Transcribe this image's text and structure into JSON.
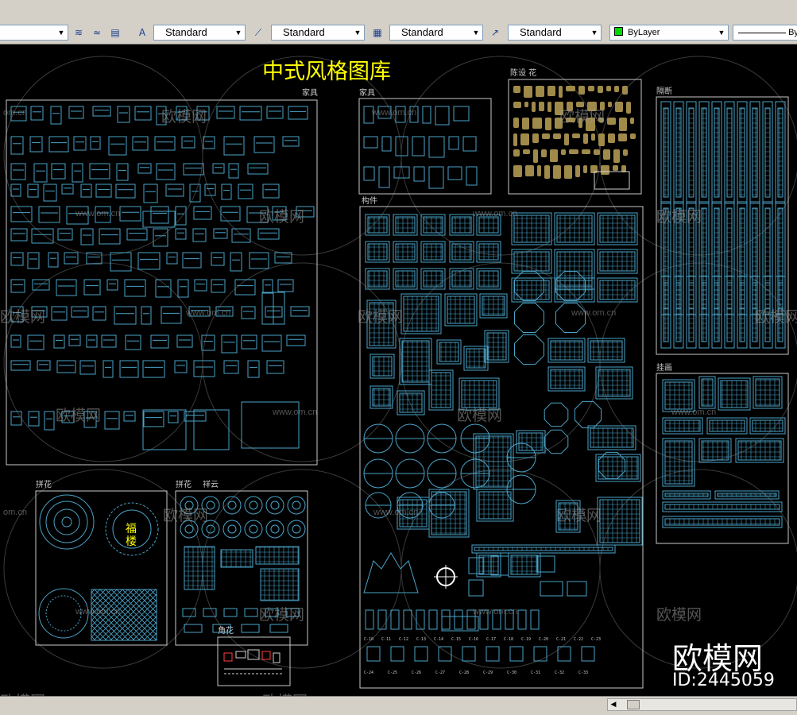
{
  "toolbar": {
    "text_style": "Standard",
    "dim_style": "Standard",
    "table_style": "Standard",
    "mleader_style": "Standard",
    "layer_color": "ByLayer",
    "linetype_prefix": "By"
  },
  "drawing": {
    "main_title": "中式风格图库",
    "sections": {
      "furniture": "家具",
      "furniture2": "家具",
      "ornaments": "陈设 花",
      "partitions": "隔断",
      "components": "构件",
      "patterns": "拼花",
      "patterns2": "拼花",
      "clouds": "祥云",
      "corners": "角花",
      "wall_hangings": "挂画"
    },
    "fu_char": "福",
    "lou_char": "楼",
    "label_row1": [
      "C-10",
      "C-11",
      "C-12",
      "C-13",
      "C-14",
      "C-15",
      "C-16",
      "C-17",
      "C-18",
      "C-19",
      "C-20",
      "C-21",
      "C-22",
      "C-23"
    ],
    "label_row2": [
      "C-24",
      "C-25",
      "C-26",
      "C-27",
      "C-28",
      "C-29",
      "C-30",
      "C-31",
      "C-32",
      "C-33"
    ]
  },
  "watermarks": {
    "brand": "欧模网",
    "domain": "www.om.cn",
    "domain_short": "om.cn",
    "big_brand": "欧模网",
    "id_label": "ID:2445059"
  },
  "colors": {
    "canvas": "#000000",
    "drawing_line": "#4aa3c8",
    "title": "#ffff00",
    "frame": "#c8c8c8",
    "gold": "#a08a4a",
    "layer_swatch": "#00d800"
  }
}
